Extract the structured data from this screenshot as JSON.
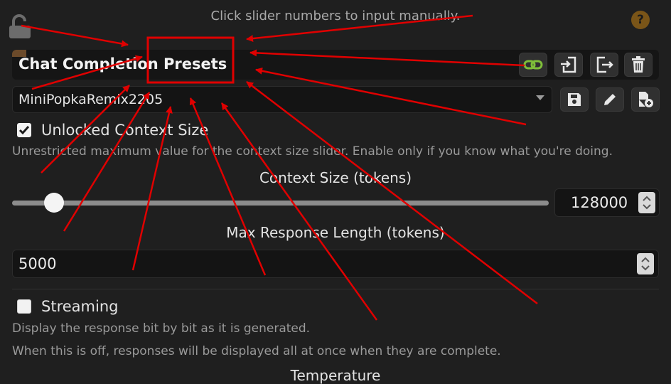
{
  "header": {
    "hint": "Click slider numbers to input manually.",
    "help_symbol": "?"
  },
  "presets": {
    "title": "Chat Completion Presets",
    "selected": "MiniPopkaRemix2205"
  },
  "unlocked_context": {
    "label": "Unlocked Context Size",
    "checked": true,
    "description": "Unrestricted maximum value for the context size slider. Enable only if you know what you're doing."
  },
  "context_size": {
    "title": "Context Size (tokens)",
    "value": "128000"
  },
  "max_response": {
    "title": "Max Response Length (tokens)",
    "value": "5000"
  },
  "streaming": {
    "label": "Streaming",
    "checked": false,
    "description1": "Display the response bit by bit as it is generated.",
    "description2": "When this is off, responses will be displayed all at once when they are complete."
  },
  "temperature": {
    "title": "Temperature"
  },
  "colors": {
    "annotation": "#e00000",
    "link_icon": "#7fbf3a",
    "help_badge": "#7a5518"
  },
  "icons": [
    "unlock-icon",
    "help-icon",
    "link-icon",
    "import-icon",
    "export-icon",
    "trash-icon",
    "save-icon",
    "edit-icon",
    "new-file-icon",
    "chevron-down-icon"
  ]
}
